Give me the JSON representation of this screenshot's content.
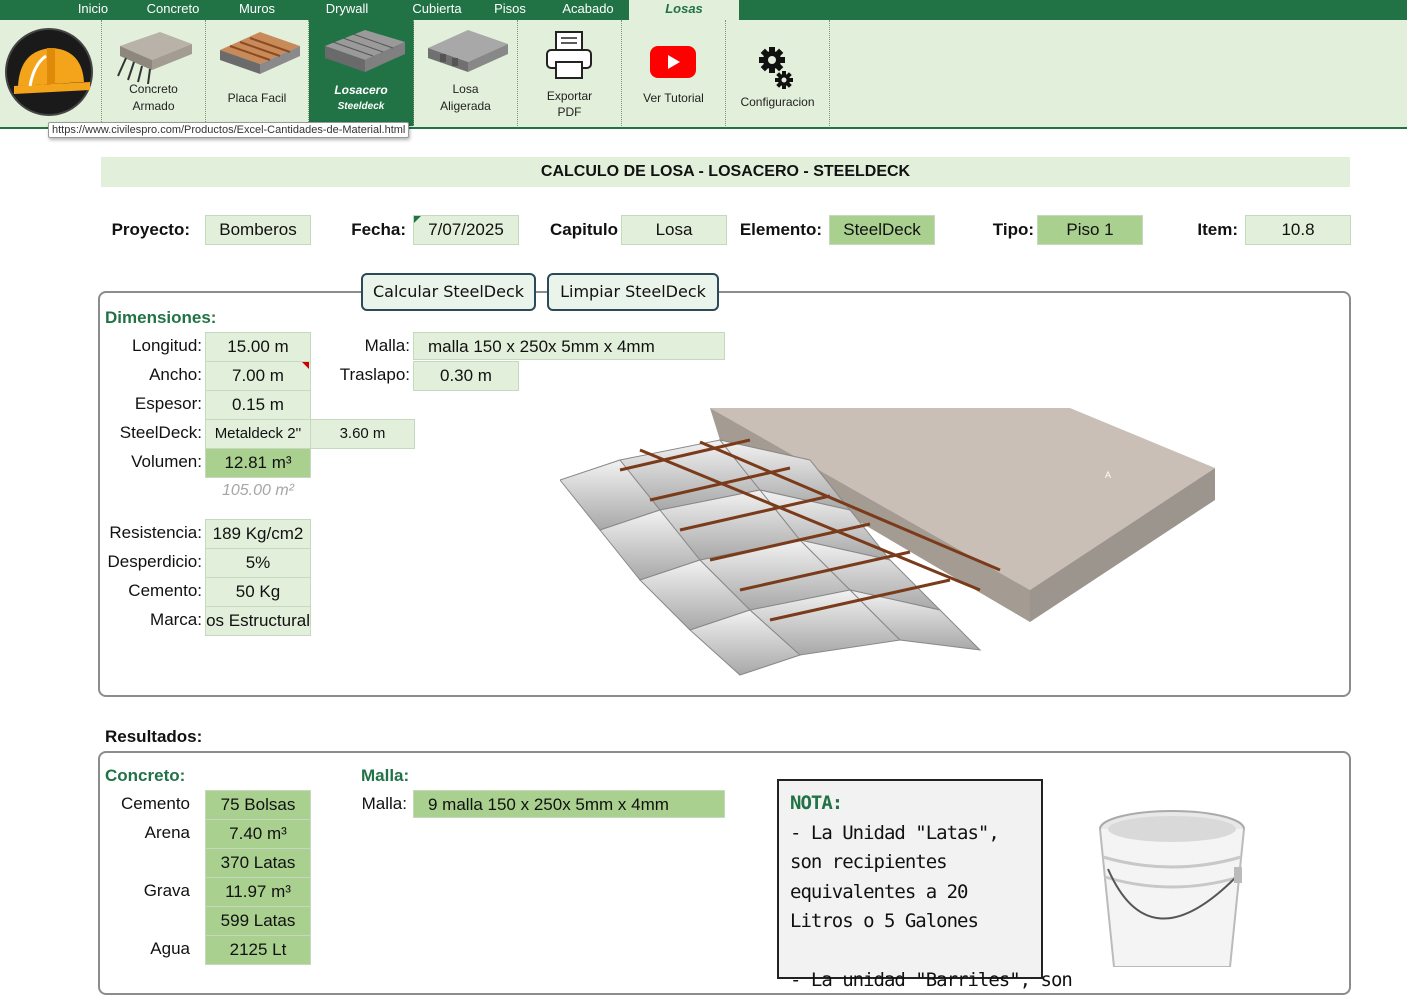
{
  "tabs": [
    {
      "label": "Inicio"
    },
    {
      "label": "Concreto"
    },
    {
      "label": "Muros"
    },
    {
      "label": "Drywall"
    },
    {
      "label": "Cubierta"
    },
    {
      "label": "Pisos"
    },
    {
      "label": "Acabado"
    },
    {
      "label": "Losas"
    }
  ],
  "ribbon": {
    "buttons": [
      {
        "l1": "Concreto",
        "l2": "Armado"
      },
      {
        "l1": "Placa Facil",
        "l2": ""
      },
      {
        "l1": "Losacero",
        "l2": "Steeldeck"
      },
      {
        "l1": "Losa",
        "l2": "Aligerada"
      },
      {
        "l1": "Exportar",
        "l2": "PDF"
      },
      {
        "l1": "Ver Tutorial",
        "l2": ""
      },
      {
        "l1": "Configuracion",
        "l2": ""
      }
    ]
  },
  "url_tooltip": "https://www.civilespro.com/Productos/Excel-Cantidades-de-Material.html",
  "title": "CALCULO DE LOSA - LOSACERO - STEELDECK",
  "header": {
    "proyecto_label": "Proyecto:",
    "proyecto": "Bomberos",
    "fecha_label": "Fecha:",
    "fecha": "7/07/2025",
    "capitulo_label": "Capitulo",
    "capitulo": "Losa",
    "elemento_label": "Elemento:",
    "elemento": "SteelDeck",
    "tipo_label": "Tipo:",
    "tipo": "Piso 1",
    "item_label": "Item:",
    "item": "10.8"
  },
  "buttons": {
    "calcular": "Calcular SteelDeck",
    "limpiar": "Limpiar SteelDeck"
  },
  "dimensiones": {
    "title": "Dimensiones:",
    "longitud_label": "Longitud:",
    "longitud": "15.00 m",
    "ancho_label": "Ancho:",
    "ancho": "7.00 m",
    "espesor_label": "Espesor:",
    "espesor": "0.15 m",
    "steeldeck_label": "SteelDeck:",
    "steeldeck": "Metaldeck 2''",
    "steeldeck_val": "3.60 m",
    "volumen_label": "Volumen:",
    "volumen": "12.81 m³",
    "area": "105.00 m²",
    "malla_label": "Malla:",
    "malla": "malla 150 x 250x 5mm x 4mm",
    "traslapo_label": "Traslapo:",
    "traslapo": "0.30 m",
    "resistencia_label": "Resistencia:",
    "resistencia": "189 Kg/cm2",
    "desperdicio_label": "Desperdicio:",
    "desperdicio": "5%",
    "cemento_label": "Cemento:",
    "cemento": "50 Kg",
    "marca_label": "Marca:",
    "marca": "Argos Estructural"
  },
  "resultados": {
    "title": "Resultados:",
    "concreto_title": "Concreto:",
    "cemento_label": "Cemento",
    "cemento": "75 Bolsas",
    "arena_label": "Arena",
    "arena": "7.40 m³",
    "arena_latas": "370 Latas",
    "grava_label": "Grava",
    "grava": "11.97 m³",
    "grava_latas": "599 Latas",
    "agua_label": "Agua",
    "agua": "2125 Lt",
    "malla_title": "Malla:",
    "malla_label": "Malla:",
    "malla": "9 malla 150 x 250x 5mm x 4mm"
  },
  "nota": {
    "title": "NOTA:",
    "p1": "- La Unidad \"Latas\", son recipientes equivalentes a 20 Litros o 5 Galones",
    "p2": "- La unidad \"Barriles\", son"
  },
  "colors": {
    "accent": "#217346",
    "light_green": "#e2efda",
    "dark_green_cell": "#a9d08e"
  },
  "icons": [
    "helmet-logo-icon",
    "concrete-slab-icon",
    "placa-facil-icon",
    "steeldeck-icon",
    "losa-aligerada-icon",
    "printer-icon",
    "youtube-icon",
    "gears-icon"
  ]
}
